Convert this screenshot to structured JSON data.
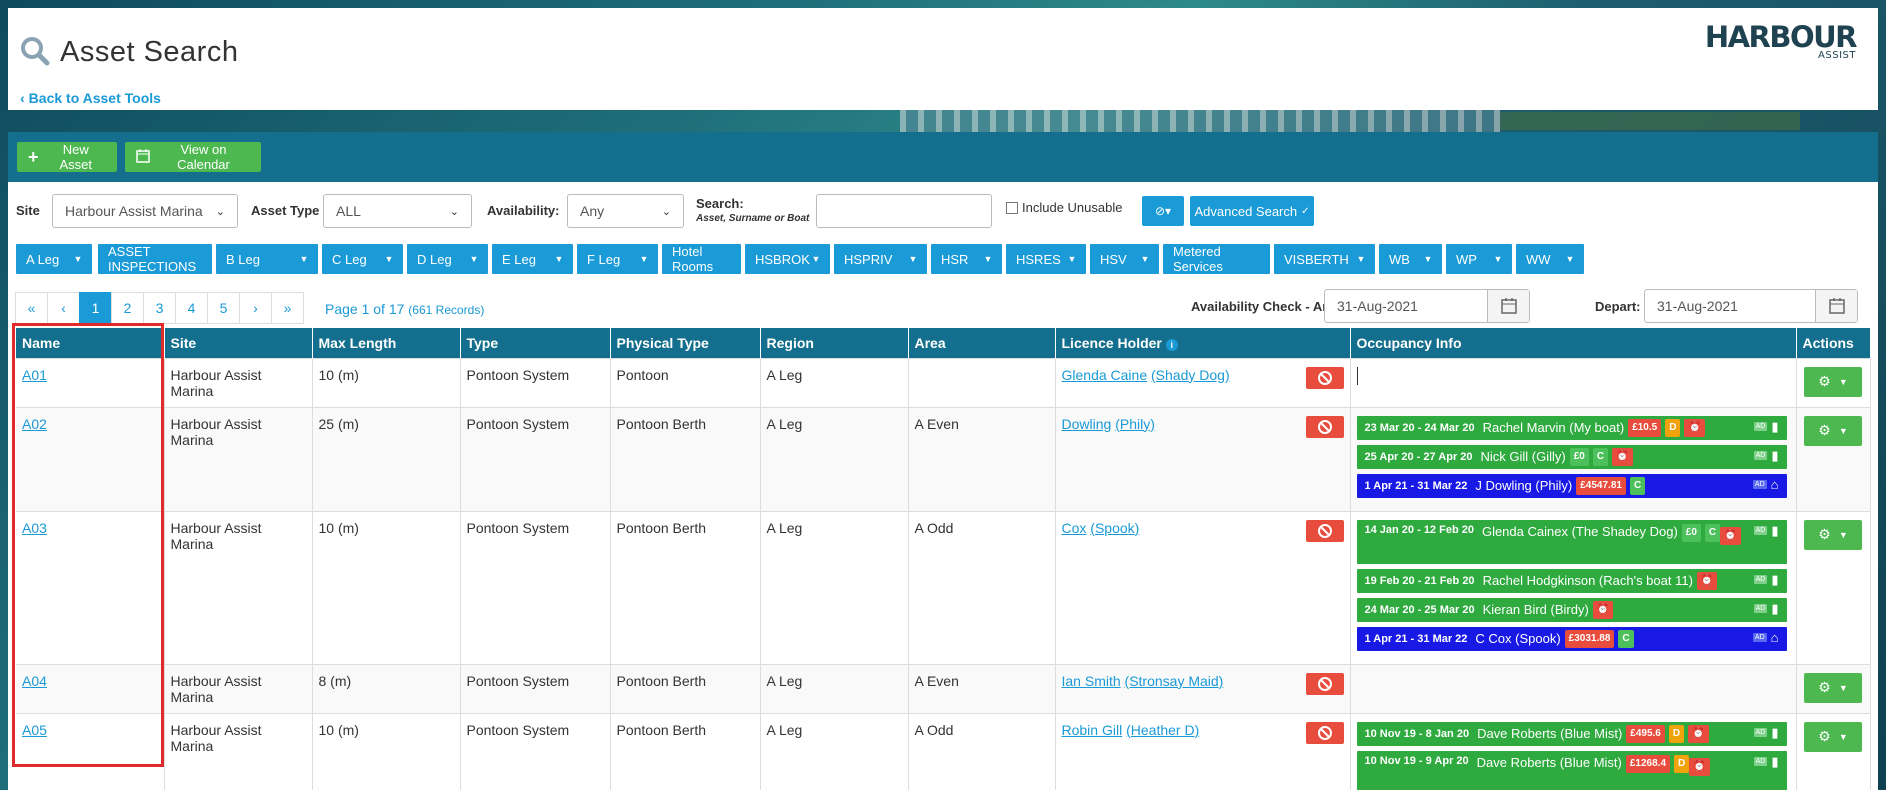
{
  "header": {
    "title": "Asset Search",
    "back_link": "Back to Asset Tools",
    "logo_main": "HARBOUR",
    "logo_sub": "ASSIST",
    "search_icon": "magnifier-icon"
  },
  "toolbar": {
    "new_asset": "New Asset",
    "view_calendar": "View on Calendar"
  },
  "filters": {
    "site_label": "Site",
    "site_value": "Harbour Assist Marina",
    "asset_type_label": "Asset Type",
    "asset_type_value": "ALL",
    "availability_label": "Availability:",
    "availability_value": "Any",
    "search_label": "Search:",
    "search_hint": "Asset, Surname or Boat",
    "search_value": "",
    "include_unusable": "Include Unusable",
    "advanced_search": "Advanced Search"
  },
  "tags": [
    "A Leg",
    "ASSET INSPECTIONS",
    "B Leg",
    "C Leg",
    "D Leg",
    "E Leg",
    "F Leg",
    "Hotel Rooms",
    "HSBROK",
    "HSPRIV",
    "HSR",
    "HSRES",
    "HSV",
    "Metered Services",
    "VISBERTH",
    "WB",
    "WP",
    "WW"
  ],
  "pagination": {
    "pages": [
      "«",
      "‹",
      "1",
      "2",
      "3",
      "4",
      "5",
      "›",
      "»"
    ],
    "active": "1",
    "info": "Page 1 of 17",
    "records": "(661 Records)"
  },
  "availability_check": {
    "arrival_label": "Availability Check - Arrival:",
    "arrival_value": "31-Aug-2021",
    "depart_label": "Depart:",
    "depart_value": "31-Aug-2021"
  },
  "table": {
    "headers": [
      "Name",
      "Site",
      "Max Length",
      "Type",
      "Physical Type",
      "Region",
      "Area",
      "Licence Holder",
      "Occupancy Info",
      "Actions"
    ],
    "rows": [
      {
        "name": "A01",
        "site": "Harbour Assist Marina",
        "max_length": "10 (m)",
        "type": "Pontoon System",
        "physical": "Pontoon",
        "region": "A Leg",
        "area": "",
        "holder": "Glenda Caine",
        "boat": "(Shady Dog)"
      },
      {
        "name": "A02",
        "site": "Harbour Assist Marina",
        "max_length": "25 (m)",
        "type": "Pontoon System",
        "physical": "Pontoon Berth",
        "region": "A Leg",
        "area": "A Even",
        "holder": "Dowling",
        "boat": "(Phily)"
      },
      {
        "name": "A03",
        "site": "Harbour Assist Marina",
        "max_length": "10 (m)",
        "type": "Pontoon System",
        "physical": "Pontoon Berth",
        "region": "A Leg",
        "area": "A Odd",
        "holder": "Cox",
        "boat": "(Spook)"
      },
      {
        "name": "A04",
        "site": "Harbour Assist Marina",
        "max_length": "8 (m)",
        "type": "Pontoon System",
        "physical": "Pontoon Berth",
        "region": "A Leg",
        "area": "A Even",
        "holder": "Ian Smith",
        "boat": "(Stronsay Maid)"
      },
      {
        "name": "A05",
        "site": "Harbour Assist Marina",
        "max_length": "10 (m)",
        "type": "Pontoon System",
        "physical": "Pontoon Berth",
        "region": "A Leg",
        "area": "A Odd",
        "holder": "Robin Gill",
        "boat": "(Heather D)"
      }
    ]
  },
  "bookings": {
    "a02": [
      {
        "dates": "23 Mar 20 - 24 Mar 20",
        "name": "Rachel Marvin (My boat)",
        "amount": "£10.5",
        "flag": "D"
      },
      {
        "dates": "25 Apr 20 - 27 Apr 20",
        "name": "Nick Gill (Gilly)",
        "amount": "£0",
        "flag": "C"
      },
      {
        "dates": "1 Apr 21 - 31 Mar 22",
        "name": "J Dowling (Phily)",
        "amount": "£4547.81",
        "flag": "C"
      }
    ],
    "a03": [
      {
        "dates": "14 Jan 20 - 12 Feb 20",
        "name": "Glenda Cainex (The Shadey Dog)",
        "amount": "£0",
        "flag": "C"
      },
      {
        "dates": "19 Feb 20 - 21 Feb 20",
        "name": "Rachel Hodgkinson (Rach's boat 11)"
      },
      {
        "dates": "24 Mar 20 - 25 Mar 20",
        "name": "Kieran Bird (Birdy)"
      },
      {
        "dates": "1 Apr 21 - 31 Mar 22",
        "name": "C Cox (Spook)",
        "amount": "£3031.88",
        "flag": "C"
      }
    ],
    "a05": [
      {
        "dates": "10 Nov 19 - 8 Jan 20",
        "name": "Dave Roberts (Blue Mist)",
        "amount": "£495.6",
        "flag": "D"
      },
      {
        "dates": "10 Nov 19 - 9 Apr 20",
        "name": "Dave Roberts (Blue Mist)",
        "amount": "£1268.4",
        "flag": "D"
      }
    ],
    "ad_label": "AD"
  },
  "colors": {
    "accent": "#1a9ad6",
    "header_bar": "#136f8d",
    "green": "#4cb84f",
    "red": "#e84c3d",
    "booking_green": "#2faa3f",
    "booking_blue": "#1919e6"
  }
}
